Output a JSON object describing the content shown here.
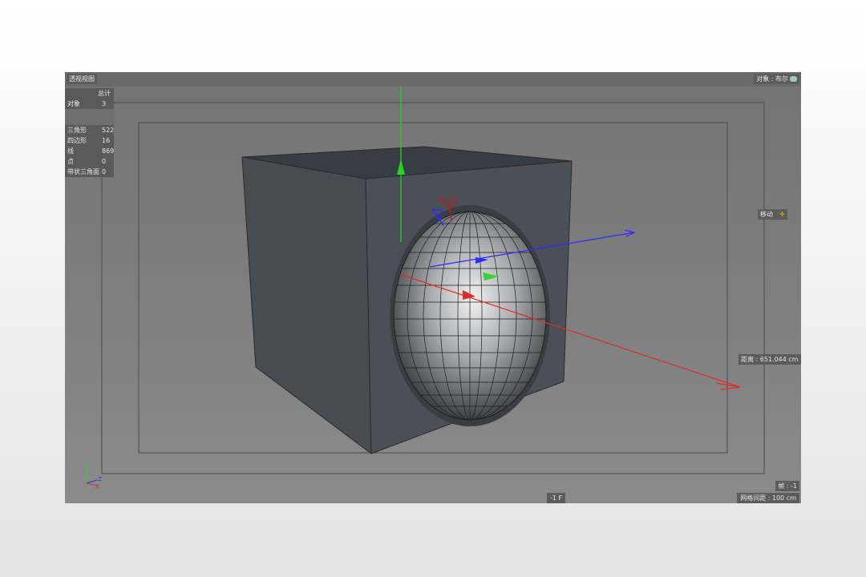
{
  "viewport": {
    "title": "透视视图",
    "object_label": "对象 : 布尔",
    "tool_label": "移动",
    "distance_label": "距离 : 651.044 cm",
    "frame_label": "帧 : -1",
    "frame_bottom": "-1 F",
    "grid_spacing": "网格间距 : 100 cm"
  },
  "stats": {
    "header": "总计",
    "rows": [
      {
        "label": "对象",
        "value": "3"
      },
      {
        "label": "三角形",
        "value": "522"
      },
      {
        "label": "四边形",
        "value": "16"
      },
      {
        "label": "线",
        "value": "869"
      },
      {
        "label": "点",
        "value": "0"
      },
      {
        "label": "带状三角面",
        "value": "0"
      }
    ]
  },
  "axis_labels": {
    "y": "Y",
    "z": "Z",
    "x": "X"
  },
  "colors": {
    "viewport_bg": "#7b7b7b",
    "cube_face": "#4a4f55",
    "axis_x": "#ff2a2a",
    "axis_y": "#22d622",
    "axis_z": "#2b2bff",
    "tool_accent": "#f0b400"
  }
}
